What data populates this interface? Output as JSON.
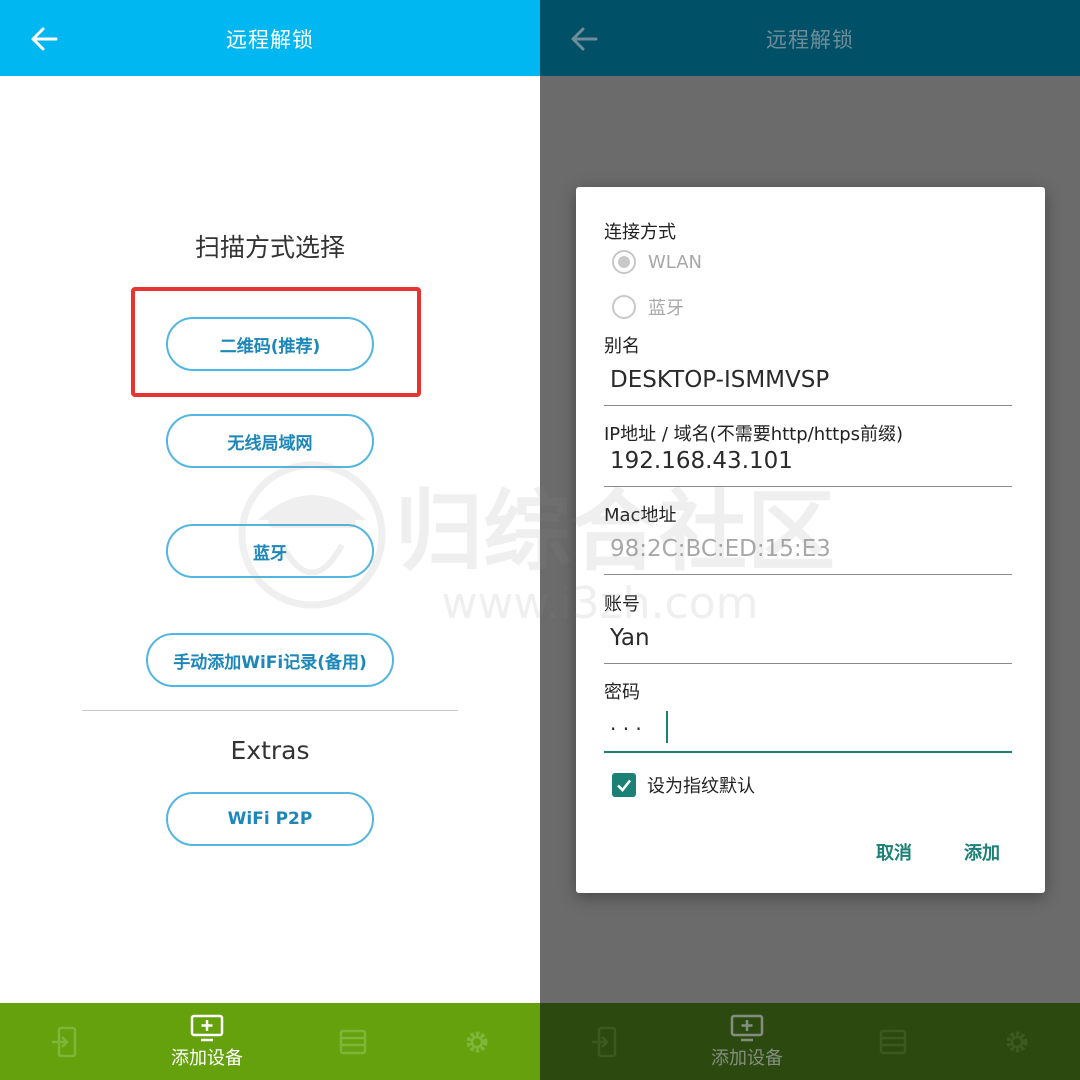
{
  "app_title": "远程解锁",
  "scan_screen": {
    "section_title": "扫描方式选择",
    "buttons": {
      "qr": "二维码(推荐)",
      "lan": "无线局域网",
      "bluetooth": "蓝牙",
      "manual_wifi": "手动添加WiFi记录(备用)"
    },
    "extras_title": "Extras",
    "wifi_p2p": "WiFi P2P"
  },
  "bottom_nav": {
    "add_device_label": "添加设备"
  },
  "dialog": {
    "connection_label": "连接方式",
    "options": [
      "WLAN",
      "蓝牙"
    ],
    "selected_option": "WLAN",
    "alias_label": "别名",
    "alias_value": "DESKTOP-ISMMVSP",
    "ip_label": "IP地址 / 域名(不需要http/https前缀)",
    "ip_value": "192.168.43.101",
    "mac_label": "Mac地址",
    "mac_value": "98:2C:BC:ED:15:E3",
    "account_label": "账号",
    "account_value": "Yan",
    "password_label": "密码",
    "password_value": "· · ·",
    "fingerprint_default_label": "设为指纹默认",
    "fingerprint_default_checked": true,
    "cancel_label": "取消",
    "add_label": "添加"
  },
  "watermark": {
    "brand": "归综合社区",
    "url": "www.i3zh.com"
  },
  "colors": {
    "appbar_left": "#00b7f1",
    "appbar_right": "#005068",
    "bottombar_left": "#65a10d",
    "bottombar_right": "#2c4a10",
    "pill_border": "#53b6e0",
    "highlight_red": "#e63431",
    "dialog_accent": "#1b8076"
  }
}
